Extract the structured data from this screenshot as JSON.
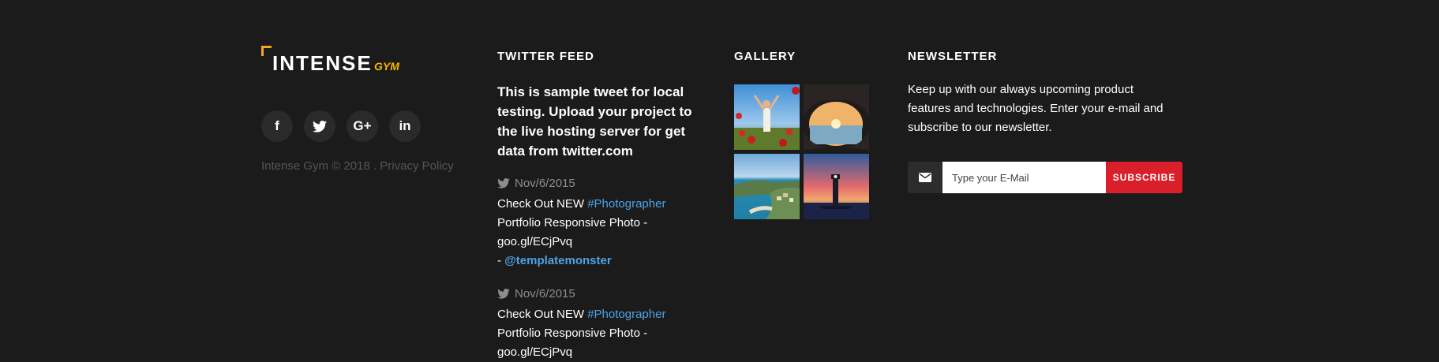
{
  "brand": {
    "logo_main": "INTENSE",
    "logo_sub": "GYM",
    "socials": [
      {
        "name": "facebook",
        "glyph": "f"
      },
      {
        "name": "twitter",
        "glyph": ""
      },
      {
        "name": "google-plus",
        "glyph": "G+"
      },
      {
        "name": "linkedin",
        "glyph": "in"
      }
    ],
    "copyright": "Intense Gym © 2018 . Privacy Policy"
  },
  "twitter": {
    "heading": "TWITTER FEED",
    "featured": "This is sample tweet for local testing. Upload your project to the live hosting server for get data from twitter.com",
    "tweets": [
      {
        "date": "Nov/6/2015",
        "pre": "Check Out NEW ",
        "hashtag": "#Photographer",
        "body": " Portfolio Responsive Photo - goo.gl/ECjPvq",
        "dash": "- ",
        "mention": "@templatemonster"
      },
      {
        "date": "Nov/6/2015",
        "pre": "Check Out NEW ",
        "hashtag": "#Photographer",
        "body": " Portfolio Responsive Photo - goo.gl/ECjPvq",
        "dash": "",
        "mention": ""
      }
    ]
  },
  "gallery": {
    "heading": "GALLERY",
    "images": [
      "woman-in-poppy-field",
      "sunset-through-cave",
      "coastal-town-beach",
      "lighthouse-at-sunset"
    ]
  },
  "newsletter": {
    "heading": "NEWSLETTER",
    "text": "Keep up with our always upcoming product features and technologies. Enter your e-mail and subscribe to our newsletter.",
    "placeholder": "Type your E-Mail",
    "button": "SUBSCRIBE",
    "icon": "mail-icon"
  },
  "colors": {
    "background": "#1b1b1c",
    "accent_yellow": "#f5b800",
    "link_blue": "#4da3e6",
    "subscribe_red": "#d9202a"
  }
}
